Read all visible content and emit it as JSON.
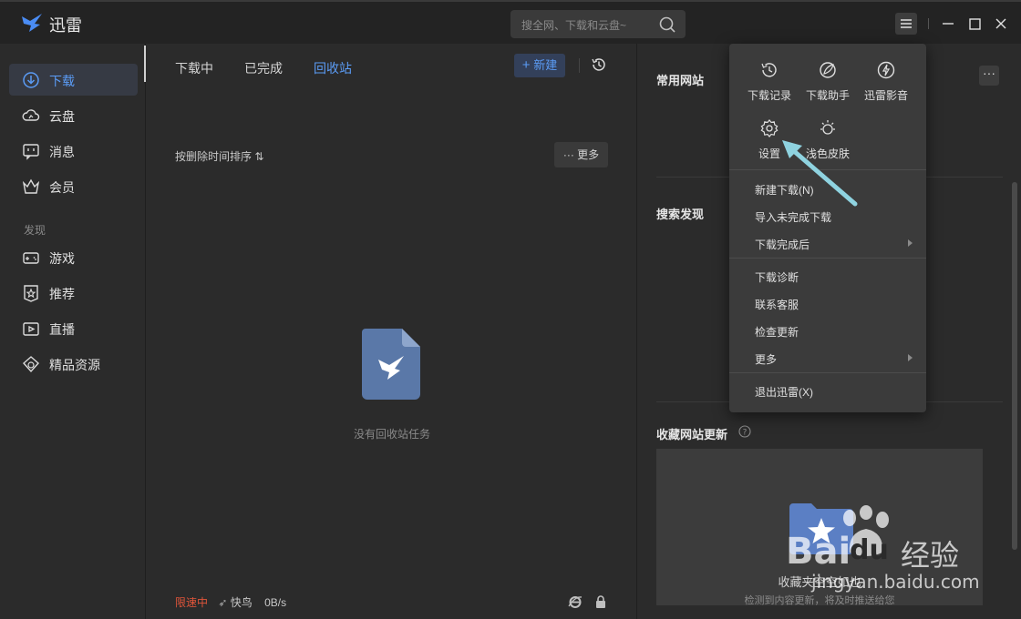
{
  "app": {
    "title": "迅雷",
    "brand_color": "#4a8cf4"
  },
  "search": {
    "placeholder": "搜全网、下载和云盘~"
  },
  "sidebar": {
    "items": [
      {
        "label": "下载",
        "icon": "download-icon",
        "active": true
      },
      {
        "label": "云盘",
        "icon": "cloud-icon"
      },
      {
        "label": "消息",
        "icon": "message-icon"
      },
      {
        "label": "会员",
        "icon": "crown-icon"
      }
    ],
    "section": "发现",
    "discover": [
      {
        "label": "游戏",
        "icon": "gamepad-icon"
      },
      {
        "label": "推荐",
        "icon": "star-badge-icon"
      },
      {
        "label": "直播",
        "icon": "live-icon"
      },
      {
        "label": "精品资源",
        "icon": "gem-icon"
      }
    ]
  },
  "center": {
    "tabs": [
      "下载中",
      "已完成",
      "回收站"
    ],
    "active_tab": "回收站",
    "new_button": "新建",
    "sort_label": "按删除时间排序 ⇅",
    "more_button": "··· 更多",
    "empty_text": "没有回收站任务"
  },
  "status": {
    "speed_limit": "限速中",
    "fast_bird": "快鸟",
    "speed": "0B/s"
  },
  "right": {
    "common_sites": "常用网站",
    "search_discover": "搜索发现",
    "fav_updates": "收藏网站更新",
    "fav_box_title": "收藏夹空空如也",
    "fav_box_desc": "检测到内容更新，将及时推送给您"
  },
  "menu": {
    "grid": [
      {
        "label": "下载记录",
        "icon": "history-icon"
      },
      {
        "label": "下载助手",
        "icon": "download-helper-icon"
      },
      {
        "label": "迅雷影音",
        "icon": "player-icon"
      },
      {
        "label": "设置",
        "icon": "settings-gear-icon"
      },
      {
        "label": "浅色皮肤",
        "icon": "light-skin-icon"
      }
    ],
    "items": [
      {
        "label": "新建下载(N)"
      },
      {
        "label": "导入未完成下载"
      },
      {
        "label": "下载完成后",
        "submenu": true
      },
      {
        "label": "下载诊断"
      },
      {
        "label": "联系客服"
      },
      {
        "label": "检查更新"
      },
      {
        "label": "更多",
        "submenu": true
      },
      {
        "label": "退出迅雷(X)"
      }
    ]
  },
  "watermark": {
    "text1": "Bai",
    "text2": "du",
    "text3": "经验",
    "text4": "jingyan.baidu.com"
  }
}
